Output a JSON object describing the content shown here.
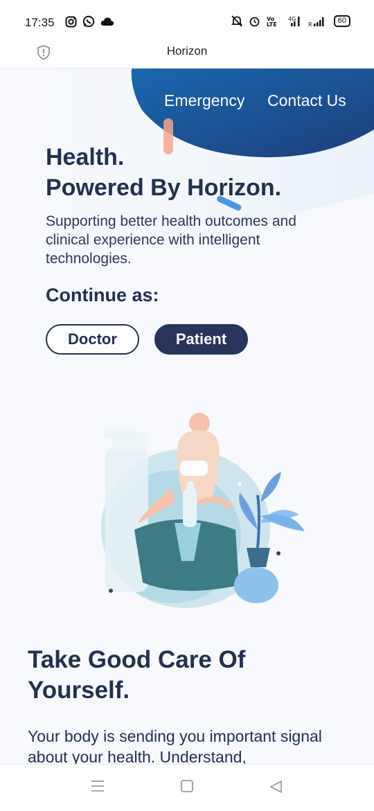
{
  "status_bar": {
    "time": "17:35",
    "left_icons": [
      "instagram-icon",
      "whatsapp-icon",
      "cloud-icon"
    ],
    "right_icons": [
      "mute-icon",
      "alarm-icon",
      "volte-icon",
      "4g-signal-icon",
      "signal-r-icon"
    ],
    "battery": "60"
  },
  "title_bar": {
    "title": "Horizon",
    "left_icon": "shield-icon"
  },
  "header": {
    "nav": [
      "Emergency",
      "Contact Us"
    ]
  },
  "hero": {
    "title_line1": "Health.",
    "title_line2": "Powered By Horizon.",
    "subtitle": "Supporting better health outcomes and clinical experience with intelligent technologies.",
    "continue_label": "Continue as:",
    "buttons": [
      "Doctor",
      "Patient"
    ]
  },
  "section": {
    "title": "Take Good Care Of Yourself.",
    "body": "Your body is sending you important signal about your health. Understand,"
  },
  "nav_bar": {
    "icons": [
      "menu-icon",
      "home-square-icon",
      "back-triangle-icon"
    ]
  },
  "colors": {
    "primary_dark": "#23304f",
    "blob_blue": "#1c5a9c",
    "teal": "#3d7c84"
  }
}
